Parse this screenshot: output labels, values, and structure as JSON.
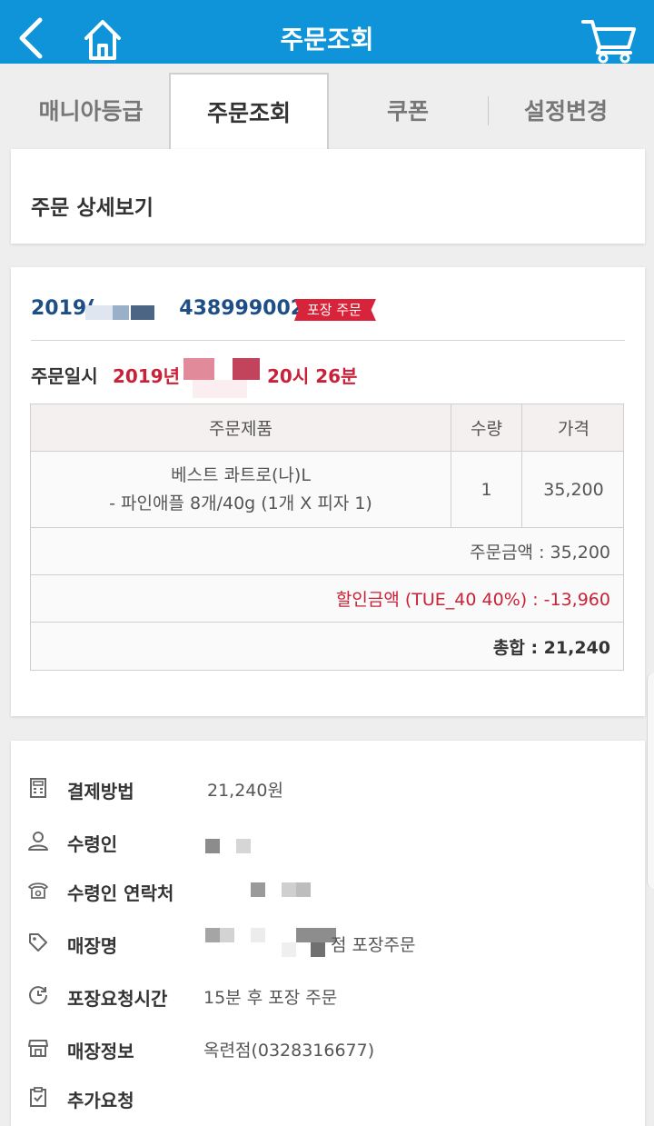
{
  "header": {
    "title": "주문조회"
  },
  "tabs": [
    {
      "label": "매니아등급"
    },
    {
      "label": "주문조회"
    },
    {
      "label": "쿠폰"
    },
    {
      "label": "설정변경"
    }
  ],
  "section": {
    "title": "주문 상세보기"
  },
  "order": {
    "number_prefix": "2019(",
    "number_suffix": "4389990020",
    "badge": "포장 주문",
    "date_label": "주문일시",
    "date_prefix": "2019년",
    "date_suffix": "20시 26분",
    "table": {
      "headers": [
        "주문제품",
        "수량",
        "가격"
      ],
      "item": {
        "name_line1": "베스트 콰트로(나)L",
        "name_line2": "- 파인애플 8개/40g (1개 X 피자 1)",
        "qty": "1",
        "price": "35,200"
      },
      "order_amount": "주문금액 : 35,200",
      "discount": "할인금액 (TUE_40 40%) : -13,960",
      "total": "총합 : 21,240"
    }
  },
  "details": [
    {
      "icon": "calculator-icon",
      "label": "결제방법",
      "value": "21,240원"
    },
    {
      "icon": "person-icon",
      "label": "수령인",
      "value": ""
    },
    {
      "icon": "phone-icon",
      "label": "수령인 연락처",
      "value": ""
    },
    {
      "icon": "tag-icon",
      "label": "매장명",
      "value": "점 포장주문"
    },
    {
      "icon": "clock-icon",
      "label": "포장요청시간",
      "value": "15분 후 포장 주문"
    },
    {
      "icon": "store-icon",
      "label": "매장정보",
      "value": "옥련점(0328316677)"
    },
    {
      "icon": "clipboard-icon",
      "label": "추가요청",
      "value": ""
    }
  ],
  "colors": {
    "header_bg": "#0f93d9",
    "order_no": "#1d4e86",
    "accent_red": "#c92238",
    "badge_bg": "#d8243a"
  }
}
